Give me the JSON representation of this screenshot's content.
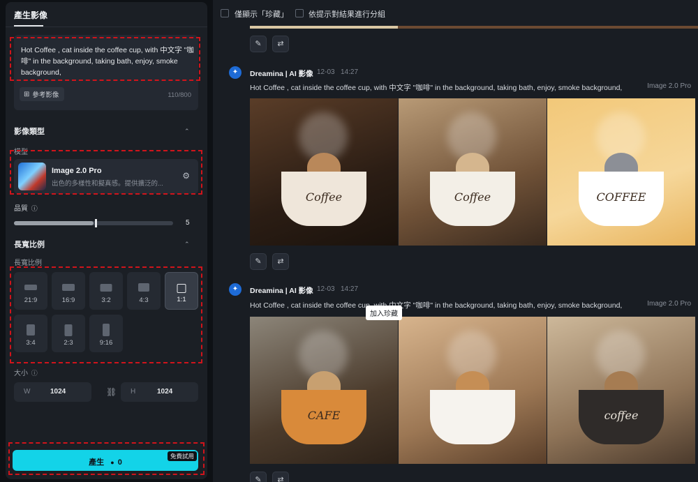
{
  "left_panel": {
    "tab": "產生影像",
    "prompt_text": "Hot Coffee , cat inside the coffee cup, with 中文字 \"咖啡\" in the background, taking bath, enjoy, smoke background,",
    "reference_button": "參考影像",
    "char_counter": "110/800",
    "image_type_section": "影像類型",
    "model_label": "模型",
    "model_name": "Image 2.0 Pro",
    "model_desc": "出色的多樣性和擬真感。提供擴泛的...",
    "quality_label": "品質",
    "quality_value": "5",
    "quality_fraction": 0.5,
    "aspect_section": "長寬比例",
    "aspect_sub": "長寬比例",
    "ratios": [
      "21:9",
      "16:9",
      "3:2",
      "4:3",
      "1:1",
      "3:4",
      "2:3",
      "9:16"
    ],
    "selected_ratio": "1:1",
    "size_label": "大小",
    "width_key": "W",
    "width_value": "1024",
    "height_key": "H",
    "height_value": "1024",
    "generate_label": "產生",
    "generate_cost": "0",
    "free_badge": "免費試用"
  },
  "right_panel": {
    "filter_favorites": "僅顯示「珍藏」",
    "group_by_prompt": "依提示對結果進行分組",
    "generations": [
      {
        "author": "Dreamina | AI 影像",
        "date": "12-03",
        "time": "14:27",
        "prompt": "Hot Coffee , cat inside the coffee cup, with 中文字 \"咖啡\" in the background, taking bath, enjoy, smoke background,",
        "model": "Image 2.0 Pro",
        "cup_texts": [
          "Coffee",
          "Coffee",
          "COFFEE"
        ]
      },
      {
        "author": "Dreamina | AI 影像",
        "date": "12-03",
        "time": "14:27",
        "prompt": "Hot Coffee , cat inside the coffee cup, with 中文字 \"咖啡\" in the background, taking bath, enjoy, smoke background,",
        "model": "Image 2.0 Pro",
        "cup_texts": [
          "CAFE",
          "",
          "coffee"
        ]
      }
    ],
    "tooltip": "加入珍藏"
  },
  "icons": {
    "edit": "✎",
    "regenerate": "⇄",
    "chevron_up": "⌃",
    "info": "ⓘ",
    "settings": "⚙",
    "link": "⛓",
    "coin": "●"
  },
  "colors": {
    "accent": "#13d3e8",
    "highlight_box": "#d0141b",
    "panel": "#1b1f25",
    "background": "#191d23"
  }
}
